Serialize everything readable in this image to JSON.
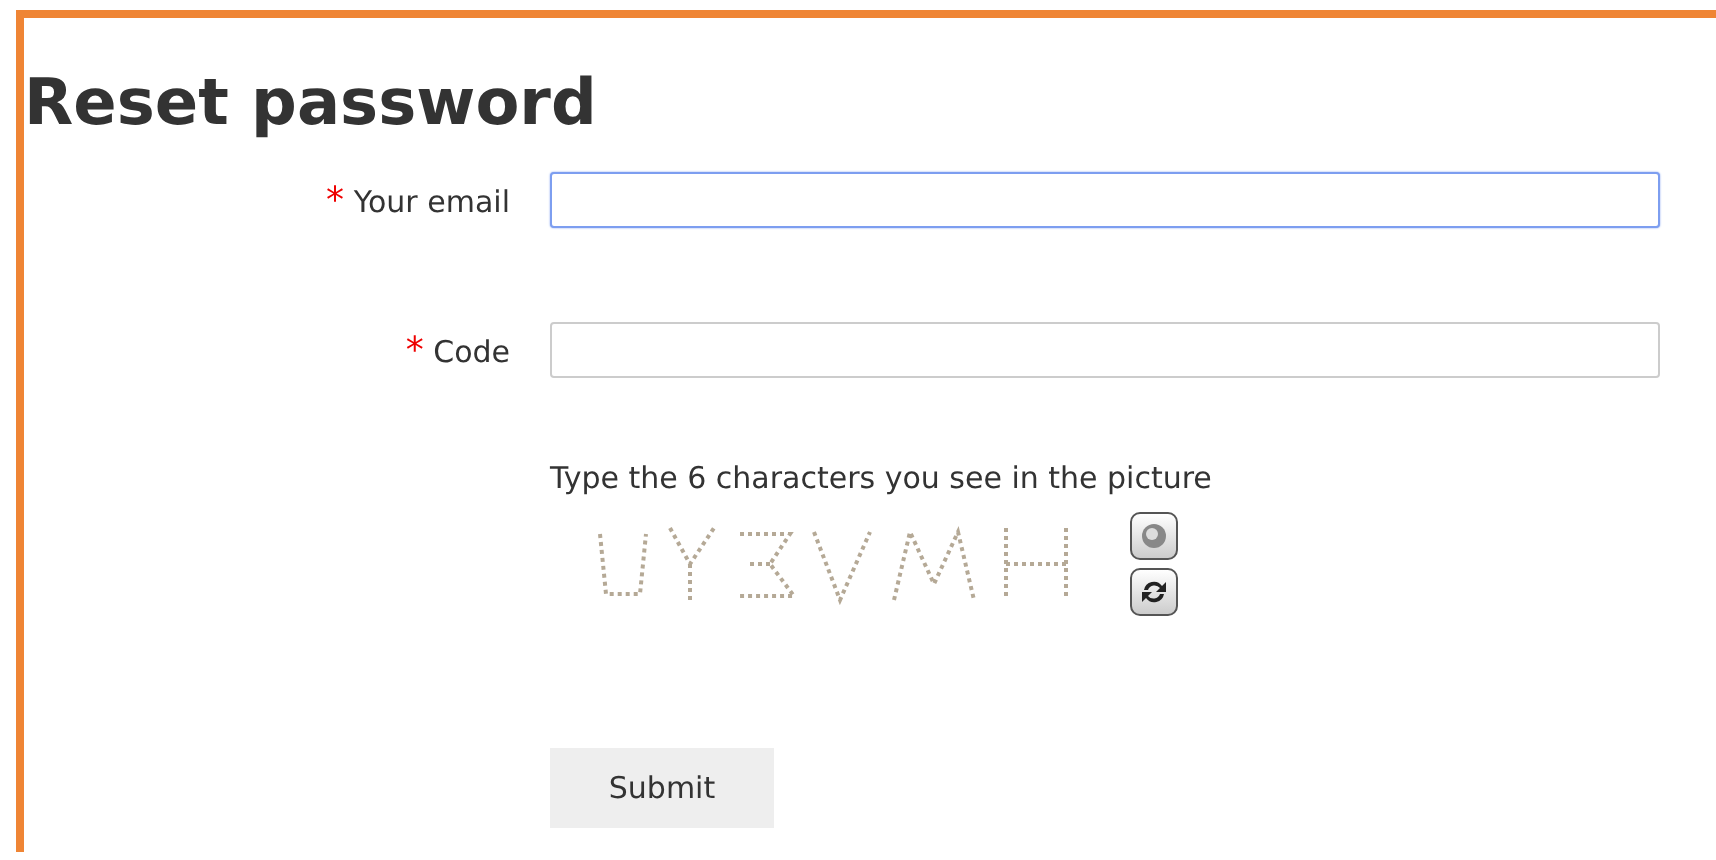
{
  "title": "Reset password",
  "fields": [
    {
      "label": "Your email",
      "required": true,
      "focused": true,
      "marker": "*"
    },
    {
      "label": "Code",
      "required": true,
      "focused": false,
      "marker": "*"
    }
  ],
  "captcha": {
    "instruction": "Type the 6 characters you see in the picture"
  },
  "submit": "Submit"
}
